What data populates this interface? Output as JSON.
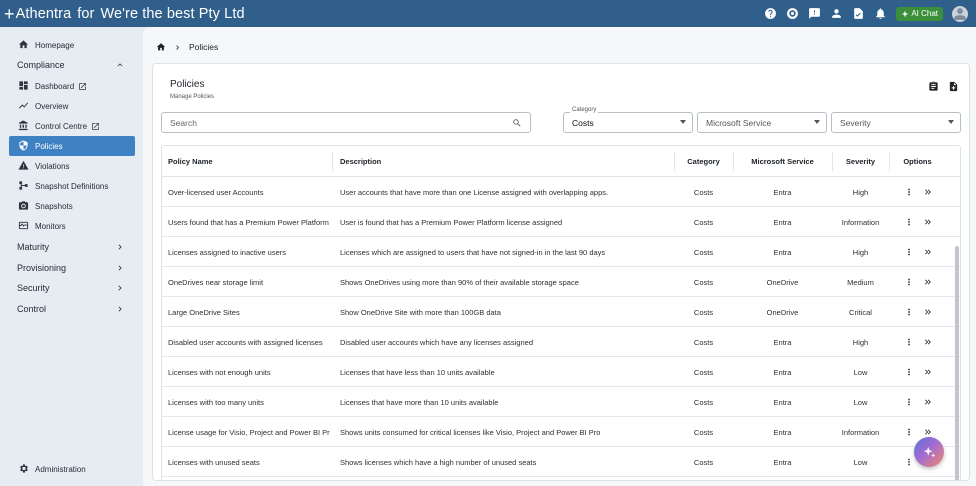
{
  "topbar": {
    "brand": "Athentra",
    "sep": "for",
    "company": "We're the best Pty Ltd",
    "ai_chat": "AI Chat"
  },
  "sidebar": {
    "homepage": "Homepage",
    "compliance": "Compliance",
    "dashboard": "Dashboard",
    "overview": "Overview",
    "control_centre": "Control Centre",
    "policies": "Policies",
    "violations": "Violations",
    "snapshot_definitions": "Snapshot Definitions",
    "snapshots": "Snapshots",
    "monitors": "Monitors",
    "maturity": "Maturity",
    "provisioning": "Provisioning",
    "security": "Security",
    "control": "Control",
    "administration": "Administration"
  },
  "breadcrumb": {
    "current": "Policies"
  },
  "card": {
    "title": "Policies",
    "subtitle": "Manage Policies"
  },
  "filters": {
    "search_placeholder": "Search",
    "category_label": "Category",
    "category_value": "Costs",
    "ms_placeholder": "Microsoft Service",
    "severity_placeholder": "Severity"
  },
  "table": {
    "headers": {
      "name": "Policy Name",
      "description": "Description",
      "category": "Category",
      "service": "Microsoft Service",
      "severity": "Severity",
      "options": "Options"
    },
    "rows": [
      {
        "name": "Over-licensed user Accounts",
        "description": "User accounts that have more than one License assigned with overlapping apps.",
        "category": "Costs",
        "service": "Entra",
        "severity": "High"
      },
      {
        "name": "Users found that has a Premium Power Platform license assigned",
        "description": "User is found that has a Premium Power Platform license assigned",
        "category": "Costs",
        "service": "Entra",
        "severity": "Information"
      },
      {
        "name": "Licenses assigned to inactive users",
        "description": "Licenses which are assigned to users that have not signed-in in the last 90 days",
        "category": "Costs",
        "service": "Entra",
        "severity": "High"
      },
      {
        "name": "OneDrives near storage limit",
        "description": "Shows OneDrives using more than 90% of their available storage space",
        "category": "Costs",
        "service": "OneDrive",
        "severity": "Medium"
      },
      {
        "name": "Large OneDrive Sites",
        "description": "Show OneDrive Site with more than 100GB data",
        "category": "Costs",
        "service": "OneDrive",
        "severity": "Critical"
      },
      {
        "name": "Disabled user accounts with assigned licenses",
        "description": "Disabled user accounts which have any licenses assigned",
        "category": "Costs",
        "service": "Entra",
        "severity": "High"
      },
      {
        "name": "Licenses with not enough units",
        "description": "Licenses that have less than 10 units available",
        "category": "Costs",
        "service": "Entra",
        "severity": "Low"
      },
      {
        "name": "Licenses with too many units",
        "description": "Licenses that have more than 10 units available",
        "category": "Costs",
        "service": "Entra",
        "severity": "Low"
      },
      {
        "name": "License usage for Visio, Project and Power BI Pro",
        "description": "Shows units consumed for critical licenses like Visio, Project and Power BI Pro",
        "category": "Costs",
        "service": "Entra",
        "severity": "Information"
      },
      {
        "name": "Licenses with unused seats",
        "description": "Shows licenses which have a high number of unused seats",
        "category": "Costs",
        "service": "Entra",
        "severity": "Low"
      }
    ]
  }
}
